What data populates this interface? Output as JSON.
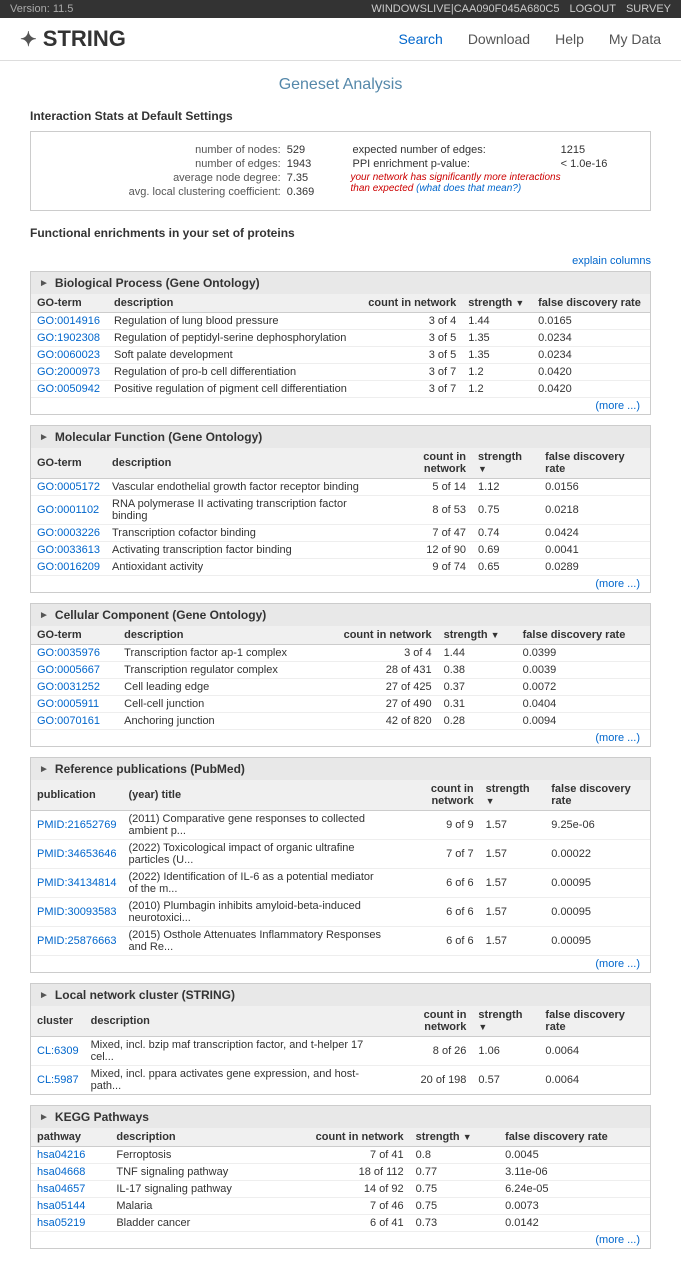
{
  "topbar": {
    "version_label": "Version:",
    "version": "11.5",
    "user": "WINDOWSLIVE|CAA090F045A680C5",
    "logout": "LOGOUT",
    "survey": "SURVEY"
  },
  "nav": {
    "logo_text": "STRING",
    "links": [
      "Search",
      "Download",
      "Help",
      "My Data"
    ]
  },
  "page": {
    "title": "Geneset Analysis"
  },
  "stats": {
    "section_title": "Interaction Stats at Default Settings",
    "left": [
      {
        "label": "number of nodes:",
        "value": "529"
      },
      {
        "label": "number of edges:",
        "value": "1943"
      },
      {
        "label": "average node degree:",
        "value": "7.35"
      },
      {
        "label": "avg. local clustering coefficient:",
        "value": "0.369"
      }
    ],
    "right": [
      {
        "label": "expected number of edges:",
        "value": "1215"
      },
      {
        "label": "PPI enrichment p-value:",
        "value": "< 1.0e-16"
      }
    ],
    "note": "your network has significantly more interactions than expected",
    "note_link": "(what does that mean?)"
  },
  "enrichment_title": "Functional enrichments in your set of proteins",
  "explain_columns": "explain columns",
  "sections": [
    {
      "id": "biological-process",
      "title": "Biological Process (Gene Ontology)",
      "columns": [
        "GO-term",
        "description",
        "count in network",
        "strength",
        "false discovery rate"
      ],
      "rows": [
        [
          "GO:0014916",
          "Regulation of lung blood pressure",
          "3 of 4",
          "1.44",
          "0.0165"
        ],
        [
          "GO:1902308",
          "Regulation of peptidyl-serine dephosphorylation",
          "3 of 5",
          "1.35",
          "0.0234"
        ],
        [
          "GO:0060023",
          "Soft palate development",
          "3 of 5",
          "1.35",
          "0.0234"
        ],
        [
          "GO:2000973",
          "Regulation of pro-b cell differentiation",
          "3 of 7",
          "1.2",
          "0.0420"
        ],
        [
          "GO:0050942",
          "Positive regulation of pigment cell differentiation",
          "3 of 7",
          "1.2",
          "0.0420"
        ]
      ],
      "more": "(more ...)"
    },
    {
      "id": "molecular-function",
      "title": "Molecular Function (Gene Ontology)",
      "columns": [
        "GO-term",
        "description",
        "count in network",
        "strength",
        "false discovery rate"
      ],
      "rows": [
        [
          "GO:0005172",
          "Vascular endothelial growth factor receptor binding",
          "5 of 14",
          "1.12",
          "0.0156"
        ],
        [
          "GO:0001102",
          "RNA polymerase II activating transcription factor binding",
          "8 of 53",
          "0.75",
          "0.0218"
        ],
        [
          "GO:0003226",
          "Transcription cofactor binding",
          "7 of 47",
          "0.74",
          "0.0424"
        ],
        [
          "GO:0033613",
          "Activating transcription factor binding",
          "12 of 90",
          "0.69",
          "0.0041"
        ],
        [
          "GO:0016209",
          "Antioxidant activity",
          "9 of 74",
          "0.65",
          "0.0289"
        ]
      ],
      "more": "(more ...)"
    },
    {
      "id": "cellular-component",
      "title": "Cellular Component (Gene Ontology)",
      "columns": [
        "GO-term",
        "description",
        "count in network",
        "strength",
        "false discovery rate"
      ],
      "rows": [
        [
          "GO:0035976",
          "Transcription factor ap-1 complex",
          "3 of 4",
          "1.44",
          "0.0399"
        ],
        [
          "GO:0005667",
          "Transcription regulator complex",
          "28 of 431",
          "0.38",
          "0.0039"
        ],
        [
          "GO:0031252",
          "Cell leading edge",
          "27 of 425",
          "0.37",
          "0.0072"
        ],
        [
          "GO:0005911",
          "Cell-cell junction",
          "27 of 490",
          "0.31",
          "0.0404"
        ],
        [
          "GO:0070161",
          "Anchoring junction",
          "42 of 820",
          "0.28",
          "0.0094"
        ]
      ],
      "more": "(more ...)"
    },
    {
      "id": "pubmed",
      "title": "Reference publications (PubMed)",
      "columns": [
        "publication",
        "(year) title",
        "count in network",
        "strength",
        "false discovery rate"
      ],
      "rows": [
        [
          "PMID:21652769",
          "(2011) Comparative gene responses to collected ambient p...",
          "9 of 9",
          "1.57",
          "9.25e-06"
        ],
        [
          "PMID:34653646",
          "(2022) Toxicological impact of organic ultrafine particles (U...",
          "7 of 7",
          "1.57",
          "0.00022"
        ],
        [
          "PMID:34134814",
          "(2022) Identification of IL-6 as a potential mediator of the m...",
          "6 of 6",
          "1.57",
          "0.00095"
        ],
        [
          "PMID:30093583",
          "(2010) Plumbagin inhibits amyloid-beta-induced neurotoxici...",
          "6 of 6",
          "1.57",
          "0.00095"
        ],
        [
          "PMID:25876663",
          "(2015) Osthole Attenuates Inflammatory Responses and Re...",
          "6 of 6",
          "1.57",
          "0.00095"
        ]
      ],
      "more": "(more ...)"
    },
    {
      "id": "local-cluster",
      "title": "Local network cluster (STRING)",
      "columns": [
        "cluster",
        "description",
        "count in network",
        "strength",
        "false discovery rate"
      ],
      "rows": [
        [
          "CL:6309",
          "Mixed, incl. bzip maf transcription factor, and t-helper 17 cel...",
          "8 of 26",
          "1.06",
          "0.0064"
        ],
        [
          "CL:5987",
          "Mixed, incl. ppara activates gene expression, and host-path...",
          "20 of 198",
          "0.57",
          "0.0064"
        ]
      ],
      "more": null
    },
    {
      "id": "kegg",
      "title": "KEGG Pathways",
      "columns": [
        "pathway",
        "description",
        "count in network",
        "strength",
        "false discovery rate"
      ],
      "rows": [
        [
          "hsa04216",
          "Ferroptosis",
          "7 of 41",
          "0.8",
          "0.0045"
        ],
        [
          "hsa04668",
          "TNF signaling pathway",
          "18 of 112",
          "0.77",
          "3.11e-06"
        ],
        [
          "hsa04657",
          "IL-17 signaling pathway",
          "14 of 92",
          "0.75",
          "6.24e-05"
        ],
        [
          "hsa05144",
          "Malaria",
          "7 of 46",
          "0.75",
          "0.0073"
        ],
        [
          "hsa05219",
          "Bladder cancer",
          "6 of 41",
          "0.73",
          "0.0142"
        ]
      ],
      "more": "(more ...)"
    }
  ]
}
